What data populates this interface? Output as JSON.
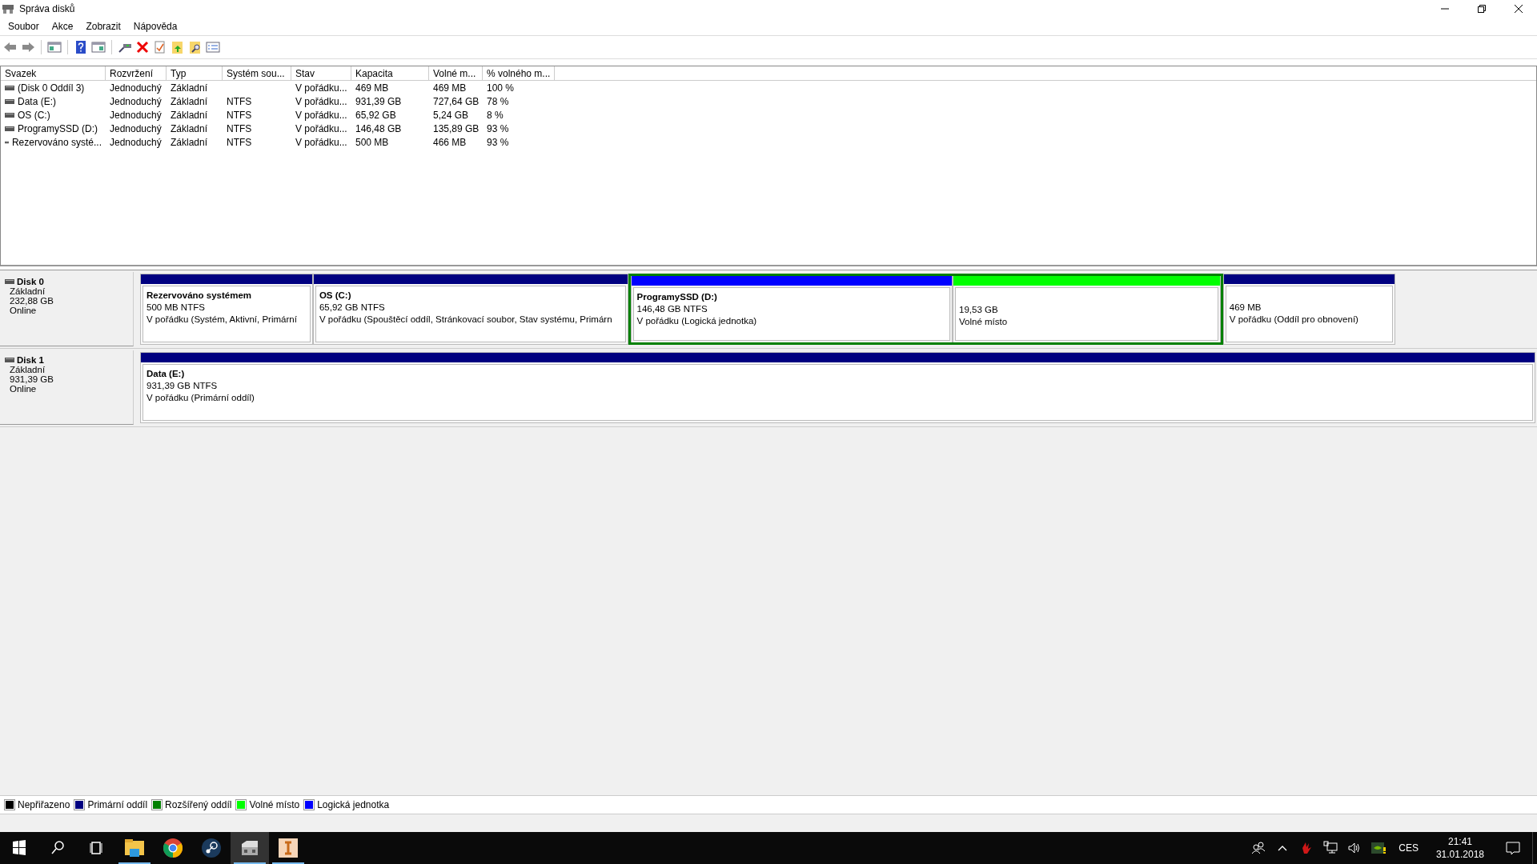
{
  "window": {
    "title": "Správa disků"
  },
  "menu": [
    "Soubor",
    "Akce",
    "Zobrazit",
    "Nápověda"
  ],
  "table": {
    "columns": [
      "Svazek",
      "Rozvržení",
      "Typ",
      "Systém sou...",
      "Stav",
      "Kapacita",
      "Volné m...",
      "% volného m..."
    ],
    "rows": [
      {
        "cells": [
          "(Disk 0 Oddíl 3)",
          "Jednoduchý",
          "Základní",
          "",
          "V pořádku...",
          "469 MB",
          "469 MB",
          "100 %"
        ]
      },
      {
        "cells": [
          "Data (E:)",
          "Jednoduchý",
          "Základní",
          "NTFS",
          "V pořádku...",
          "931,39 GB",
          "727,64 GB",
          "78 %"
        ]
      },
      {
        "cells": [
          "OS (C:)",
          "Jednoduchý",
          "Základní",
          "NTFS",
          "V pořádku...",
          "65,92 GB",
          "5,24 GB",
          "8 %"
        ]
      },
      {
        "cells": [
          "ProgramySSD (D:)",
          "Jednoduchý",
          "Základní",
          "NTFS",
          "V pořádku...",
          "146,48 GB",
          "135,89 GB",
          "93 %"
        ]
      },
      {
        "cells": [
          "Rezervováno systé...",
          "Jednoduchý",
          "Základní",
          "NTFS",
          "V pořádku...",
          "500 MB",
          "466 MB",
          "93 %"
        ]
      }
    ]
  },
  "disks": [
    {
      "name": "Disk 0",
      "type": "Základní",
      "size": "232,88 GB",
      "status": "Online",
      "partitions": [
        {
          "kind": "primary",
          "color": "#000080",
          "title": "Rezervováno systémem",
          "lines": [
            "500 MB NTFS",
            "V pořádku (Systém, Aktivní, Primární"
          ]
        },
        {
          "kind": "primary",
          "color": "#000080",
          "title": "OS  (C:)",
          "lines": [
            "65,92 GB NTFS",
            "V pořádku (Spouštěcí oddíl, Stránkovací soubor, Stav systému, Primárn"
          ]
        },
        {
          "kind": "extended",
          "color": "#008000",
          "children": [
            {
              "kind": "logical",
              "color": "#0000ff",
              "title": "ProgramySSD  (D:)",
              "lines": [
                "146,48 GB NTFS",
                "V pořádku (Logická jednotka)"
              ]
            },
            {
              "kind": "free",
              "color": "#00ff00",
              "lines": [
                "19,53 GB",
                "Volné místo"
              ]
            }
          ]
        },
        {
          "kind": "primary",
          "color": "#000080",
          "lines": [
            "469 MB",
            "V pořádku (Oddíl pro obnovení)"
          ]
        }
      ]
    },
    {
      "name": "Disk 1",
      "type": "Základní",
      "size": "931,39 GB",
      "status": "Online",
      "partitions": [
        {
          "kind": "primary",
          "color": "#000080",
          "title": "Data  (E:)",
          "lines": [
            "931,39 GB NTFS",
            "V pořádku (Primární oddíl)"
          ]
        }
      ]
    }
  ],
  "legend": [
    {
      "label": "Nepřiřazeno",
      "color": "#000000"
    },
    {
      "label": "Primární oddíl",
      "color": "#000080"
    },
    {
      "label": "Rozšířený oddíl",
      "color": "#008000"
    },
    {
      "label": "Volné místo",
      "color": "#00ff00"
    },
    {
      "label": "Logická jednotka",
      "color": "#0000ff"
    }
  ],
  "taskbar": {
    "apps": [
      {
        "kind": "explorer",
        "running": true,
        "selected": false
      },
      {
        "kind": "chrome",
        "running": false,
        "selected": false
      },
      {
        "kind": "steam",
        "running": false,
        "selected": false
      },
      {
        "kind": "diskmgmt",
        "running": true,
        "selected": true
      },
      {
        "kind": "ibooks",
        "running": true,
        "selected": false
      }
    ],
    "language": "CES",
    "time": "21:41",
    "date": "31.01.2018"
  }
}
